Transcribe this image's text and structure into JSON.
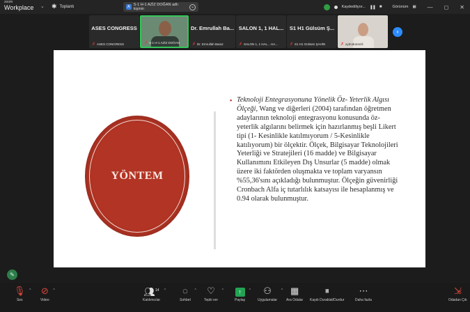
{
  "app": {
    "logo_small": "zoom",
    "logo_big": "Workplace"
  },
  "topbar": {
    "meeting_label": "Toplantı",
    "share_pill_initial": "A",
    "share_pill_text": "S-1 H-1 AZİZ DOĞAN adlı kişinin",
    "recording_text": "Kaydediliyor...",
    "view_label": "Görünüm"
  },
  "gallery": {
    "tiles": [
      {
        "big": "ASES CONGRESS",
        "name": "ASES CONGRESS"
      },
      {
        "big": "",
        "name": "S-1 H-1 AZİZ DOĞAN"
      },
      {
        "big": "Dr. Emrullah Ba...",
        "name": "Dr. Emrullah Baraz"
      },
      {
        "big": "SALON 1, 1 HAL...",
        "name": "SALON 1, 1 HAL... HA..."
      },
      {
        "big": "S1 H1 Gülsüm Ş...",
        "name": "S1 H1 Gülsüm ŞAHİN"
      },
      {
        "big": "",
        "name": "aybüdümerili"
      }
    ]
  },
  "slide": {
    "heading_word": "YÖNTEM",
    "body_italic": "Teknoloji Entegrasyonuna Yönelik Öz- Yeterlik Algısı Ölçeği,",
    "body_text": " Wang ve diğerleri (2004) tarafından öğretmen adaylarının teknoloji entegrasyonu konusunda öz-yeterlik algılarını belirmek için hazırlanmış beşli Likert tipi (1- Kesinlikle katılmıyorum / 5-Kesinlikle katılıyorum) bir ölçektir. Ölçek, Bilgisayar Teknolojileri Yeterliği ve Stratejileri (16 madde) ve Bilgisayar Kullanımını Etkileyen Dış Unsurlar (5 madde) olmak üzere iki faktörden oluşmakta ve toplam varyansın %55,36'sını açıkladığı bulunmuştur. Ölçeğin güvenirliği Cronbach Alfa iç tutarlılık katsayısı ile hesaplanmış ve 0.94 olarak bulunmuştur."
  },
  "toolbar": {
    "audio": "Ses",
    "video": "Video",
    "participants": "Katılımcılar",
    "participants_count": "14",
    "chat": "Sohbet",
    "react": "Tepki ver",
    "share": "Paylaş",
    "apps": "Uygulamalar",
    "breakout": "Ara Odalar",
    "record": "Kaydı Duraklat/Durdur",
    "more": "Daha fazla",
    "leave": "Odadan Çık"
  },
  "colors": {
    "accent": "#2d8cff",
    "active_border": "#34c759",
    "slide_red": "#b23424",
    "mute_red": "#e0483e"
  }
}
